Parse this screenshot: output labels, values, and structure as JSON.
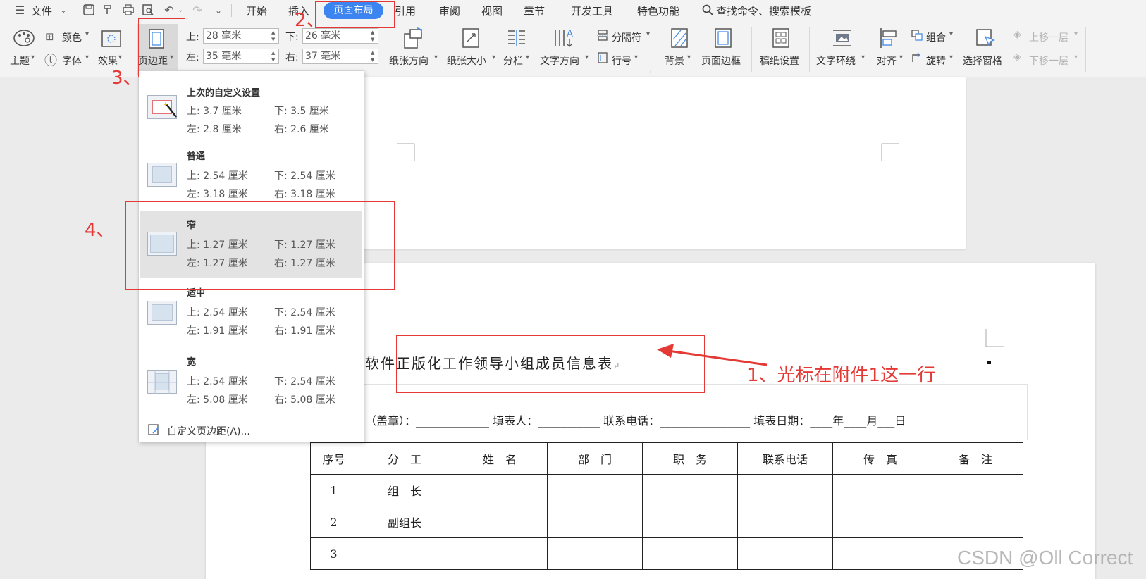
{
  "menu": {
    "file_label": "文件",
    "tabs": [
      "开始",
      "插入",
      "页面布局",
      "引用",
      "审阅",
      "视图",
      "章节",
      "开发工具",
      "特色功能"
    ],
    "active_tab": "页面布局",
    "search_placeholder": "查找命令、搜索模板"
  },
  "ribbon": {
    "theme": "主题",
    "color": "颜色",
    "font": "字体",
    "effect": "效果",
    "margins": "页边距",
    "top_label": "上:",
    "top_value": "28 毫米",
    "bottom_label": "下:",
    "bottom_value": "26 毫米",
    "left_label": "左:",
    "left_value": "35 毫米",
    "right_label": "右:",
    "right_value": "37 毫米",
    "orientation": "纸张方向",
    "size": "纸张大小",
    "columns": "分栏",
    "text_direction": "文字方向",
    "breaks": "分隔符",
    "line_numbers": "行号",
    "background": "背景",
    "page_border": "页面边框",
    "manuscript": "稿纸设置",
    "wrap": "文字环绕",
    "align": "对齐",
    "group": "组合",
    "rotate": "旋转",
    "selection_pane": "选择窗格",
    "bring_forward": "上移一层",
    "send_backward": "下移一层"
  },
  "dropdown": {
    "presets": [
      {
        "name": "上次的自定义设置",
        "top": "上: 3.7 厘米",
        "bottom": "下: 3.5 厘米",
        "left": "左: 2.8 厘米",
        "right": "右: 2.6 厘米"
      },
      {
        "name": "普通",
        "top": "上: 2.54 厘米",
        "bottom": "下: 2.54 厘米",
        "left": "左: 3.18 厘米",
        "right": "右: 3.18 厘米"
      },
      {
        "name": "窄",
        "top": "上: 1.27 厘米",
        "bottom": "下: 1.27 厘米",
        "left": "左: 1.27 厘米",
        "right": "右: 1.27 厘米"
      },
      {
        "name": "适中",
        "top": "上: 2.54 厘米",
        "bottom": "下: 2.54 厘米",
        "left": "左: 1.91 厘米",
        "right": "右: 1.91 厘米"
      },
      {
        "name": "宽",
        "top": "上: 2.54 厘米",
        "bottom": "下: 2.54 厘米",
        "left": "左: 5.08 厘米",
        "right": "右: 5.08 厘米"
      }
    ],
    "custom": "自定义页边距(A)..."
  },
  "document": {
    "title": "软件正版化工作领导小组成员信息表",
    "form_line": "（盖章）：_____________ 填表人：___________ 联系电话：________________ 填表日期：____年____月___日",
    "headers": [
      "序号",
      "分　工",
      "姓　名",
      "部　门",
      "职　务",
      "联系电话",
      "传　真",
      "备　注"
    ],
    "rows": [
      [
        "1",
        "组　长",
        "",
        "",
        "",
        "",
        "",
        ""
      ],
      [
        "2",
        "副组长",
        "",
        "",
        "",
        "",
        "",
        ""
      ],
      [
        "3",
        "",
        "",
        "",
        "",
        "",
        "",
        ""
      ]
    ]
  },
  "annotations": {
    "step1": "1、光标在附件1这一行",
    "step2": "2、",
    "step3": "3、",
    "step4": "4、",
    "color": "#e53935"
  },
  "watermark": "CSDN @Oll Correct"
}
